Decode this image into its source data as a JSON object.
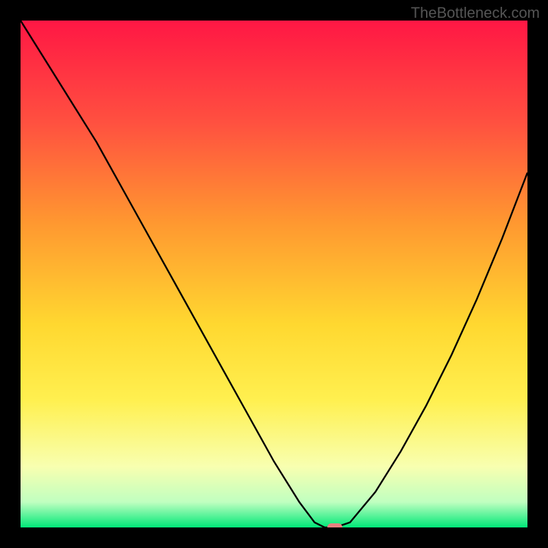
{
  "watermark": "TheBottleneck.com",
  "chart_data": {
    "type": "line",
    "title": "",
    "xlabel": "",
    "ylabel": "",
    "xlim": [
      0,
      100
    ],
    "ylim": [
      0,
      100
    ],
    "x": [
      0,
      5,
      10,
      15,
      20,
      25,
      30,
      35,
      40,
      45,
      50,
      55,
      58,
      60,
      62,
      65,
      70,
      75,
      80,
      85,
      90,
      95,
      100
    ],
    "y": [
      100,
      92,
      84,
      76,
      67,
      58,
      49,
      40,
      31,
      22,
      13,
      5,
      1,
      0,
      0,
      1,
      7,
      15,
      24,
      34,
      45,
      57,
      70
    ],
    "marker": {
      "x": 62,
      "y": 0,
      "color": "#e88080"
    },
    "gradient_stops": [
      {
        "offset": 0.0,
        "color": "#ff1744"
      },
      {
        "offset": 0.2,
        "color": "#ff5040"
      },
      {
        "offset": 0.4,
        "color": "#ff9830"
      },
      {
        "offset": 0.6,
        "color": "#ffd830"
      },
      {
        "offset": 0.75,
        "color": "#fff050"
      },
      {
        "offset": 0.88,
        "color": "#f8ffb0"
      },
      {
        "offset": 0.95,
        "color": "#c0ffc0"
      },
      {
        "offset": 1.0,
        "color": "#00e878"
      }
    ]
  }
}
